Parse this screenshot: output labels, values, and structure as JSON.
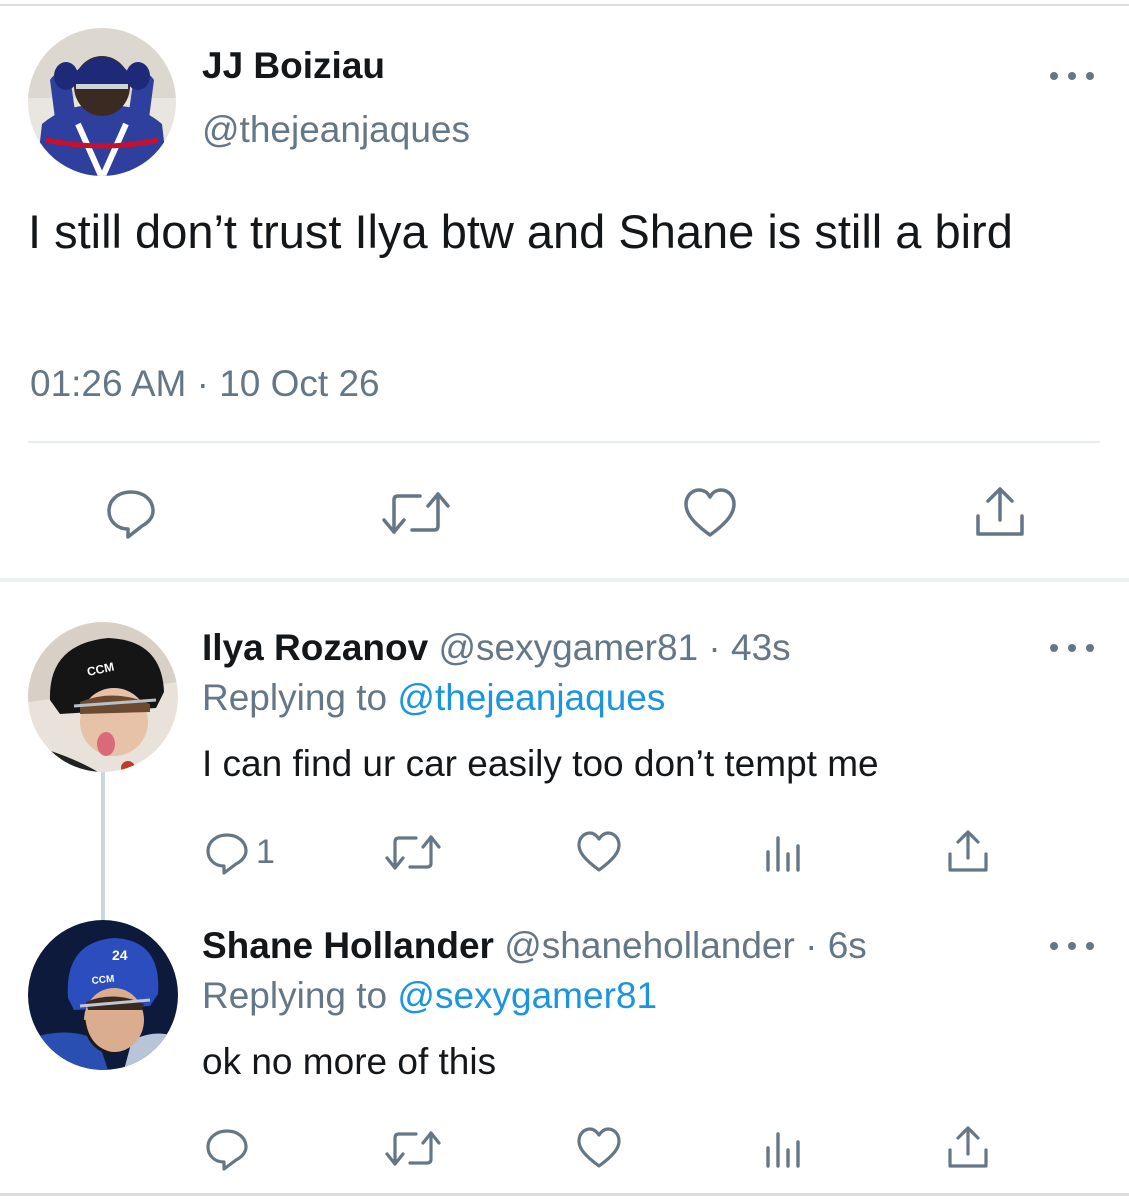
{
  "main_tweet": {
    "display_name": "JJ Boiziau",
    "handle": "@thejeanjaques",
    "text": "I still don’t trust Ilya btw and Shane is still a bird",
    "timestamp": "01:26 AM · 10 Oct 26",
    "actions": [
      "reply-icon",
      "retweet-icon",
      "like-icon",
      "share-icon"
    ]
  },
  "replies": [
    {
      "display_name": "Ilya Rozanov",
      "handle": "@sexygamer81",
      "time": "· 43s",
      "replying_prefix": "Replying to",
      "replying_to": "@thejeanjaques",
      "text": "I can find ur car easily too don’t tempt me",
      "reply_count": "1",
      "actions": [
        "reply-icon",
        "retweet-icon",
        "like-icon",
        "analytics-icon",
        "share-icon"
      ]
    },
    {
      "display_name": "Shane Hollander",
      "handle": "@shanehollander",
      "time": "· 6s",
      "replying_prefix": "Replying to",
      "replying_to": "@sexygamer81",
      "text": "ok no more of this",
      "reply_count": "",
      "actions": [
        "reply-icon",
        "retweet-icon",
        "like-icon",
        "analytics-icon",
        "share-icon"
      ]
    }
  ],
  "colors": {
    "text": "#14171a",
    "muted": "#657786",
    "link": "#1b95e0",
    "divider": "#e6ecf0"
  }
}
